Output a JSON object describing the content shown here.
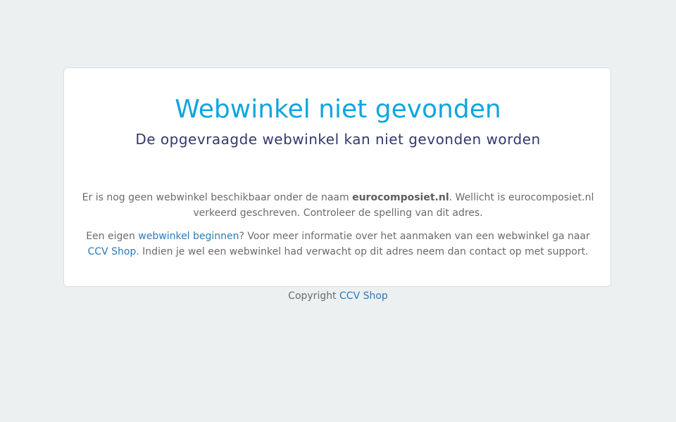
{
  "card": {
    "title": "Webwinkel niet gevonden",
    "subtitle": "De opgevraagde webwinkel kan niet gevonden worden",
    "paragraph1": {
      "before": "Er is nog geen webwinkel beschikbaar onder de naam ",
      "shop_name": "eurocomposiet.nl",
      "after": ". Wellicht is eurocomposiet.nl verkeerd geschreven. Controleer de spelling van dit adres."
    },
    "paragraph2": {
      "before": "Een eigen ",
      "link_start": "webwinkel beginnen",
      "middle": "? Voor meer informatie over het aanmaken van een webwinkel ga naar ",
      "link_ccv": "CCV Shop",
      "after": ". Indien je wel een webwinkel had verwacht op dit adres neem dan contact op met support."
    }
  },
  "footer": {
    "prefix": "Copyright ",
    "link": "CCV Shop"
  },
  "colors": {
    "background": "#ecf0f1",
    "title": "#0ea5e0",
    "subtitle": "#35386b",
    "body_text": "#6b6b6b",
    "link": "#2a7ab8"
  }
}
